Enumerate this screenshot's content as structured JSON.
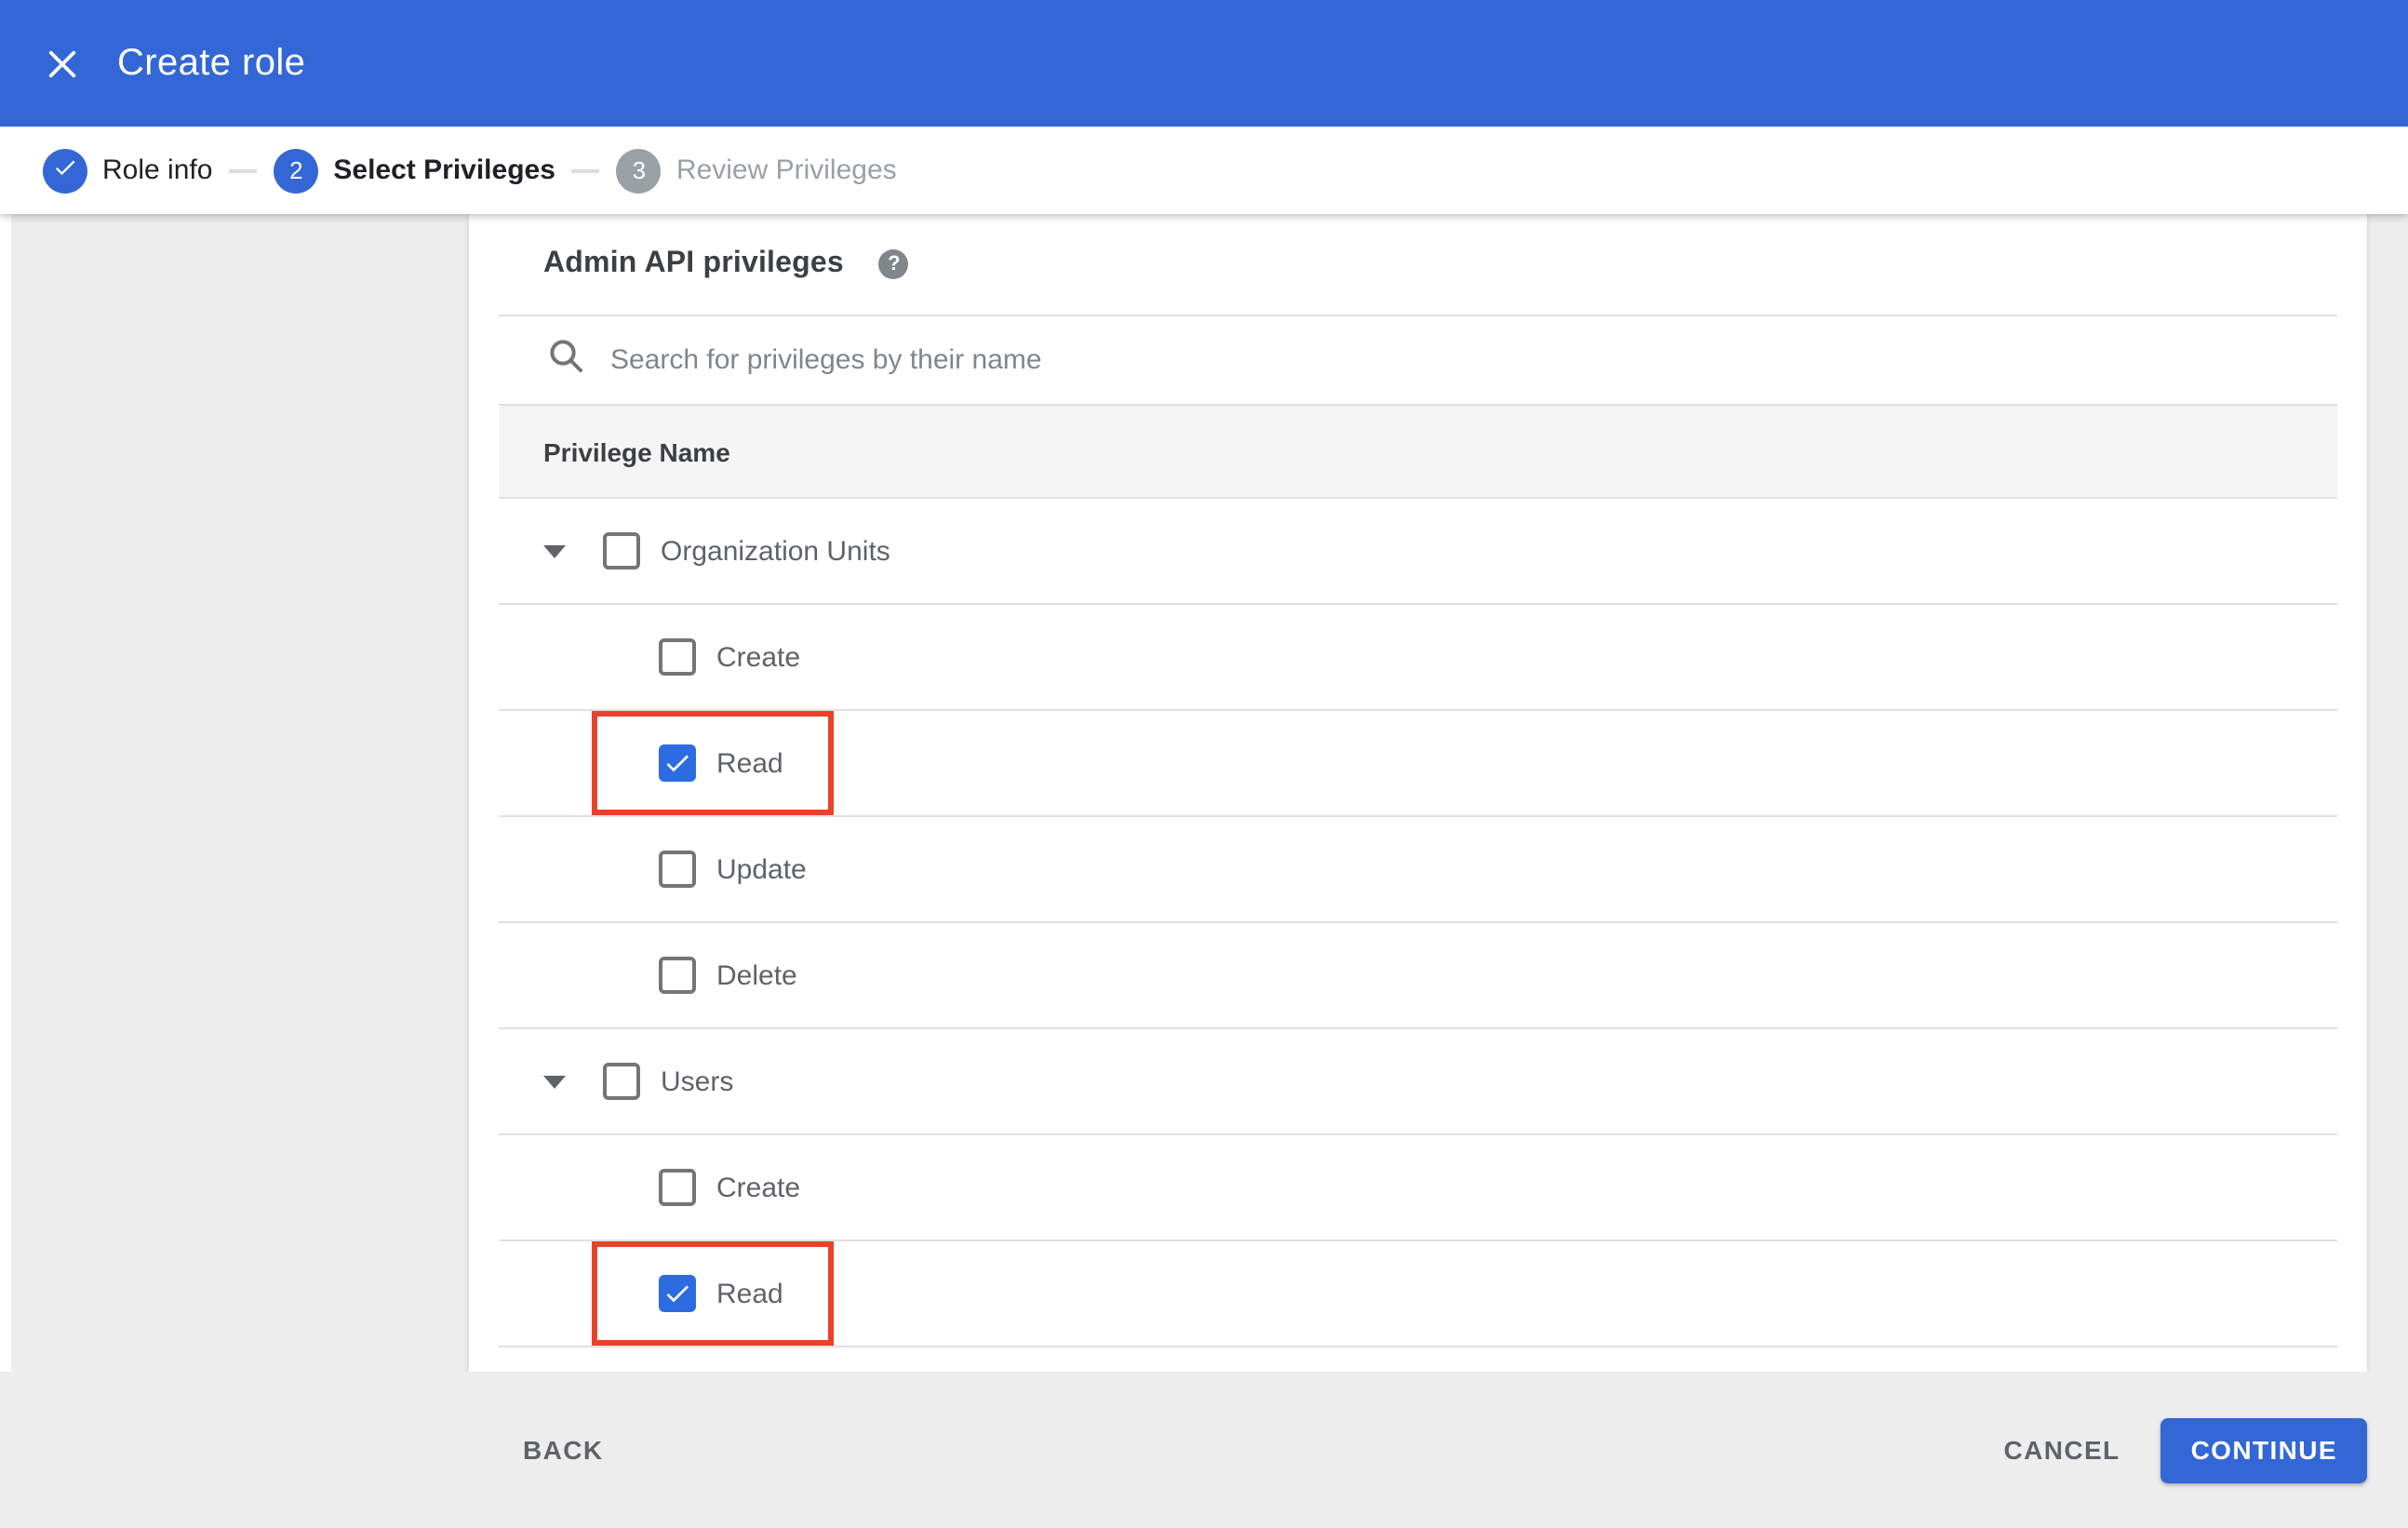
{
  "colors": {
    "accent": "#3367d6",
    "checkbox_checked": "#2d6ce0",
    "highlight_red": "#e8432a",
    "footer_bg": "#ededed"
  },
  "app_bar": {
    "title": "Create role",
    "close_icon": "x-icon"
  },
  "stepper": {
    "steps": [
      {
        "num": "",
        "label": "Role info",
        "state": "done",
        "icon": "check-icon"
      },
      {
        "num": "2",
        "label": "Select Privileges",
        "state": "active"
      },
      {
        "num": "3",
        "label": "Review Privileges",
        "state": "upcoming"
      }
    ]
  },
  "content": {
    "section_title": "Admin API privileges",
    "help_icon": "?",
    "search_placeholder": "Search for privileges by their name",
    "table_header": "Privilege Name",
    "groups": [
      {
        "label": "Organization Units",
        "expanded": true,
        "checked": false,
        "children": [
          {
            "label": "Create",
            "checked": false,
            "highlight": false
          },
          {
            "label": "Read",
            "checked": true,
            "highlight": true
          },
          {
            "label": "Update",
            "checked": false,
            "highlight": false
          },
          {
            "label": "Delete",
            "checked": false,
            "highlight": false
          }
        ]
      },
      {
        "label": "Users",
        "expanded": true,
        "checked": false,
        "children": [
          {
            "label": "Create",
            "checked": false,
            "highlight": false
          },
          {
            "label": "Read",
            "checked": true,
            "highlight": true
          }
        ]
      }
    ]
  },
  "footer": {
    "back": "BACK",
    "cancel": "CANCEL",
    "continue": "CONTINUE"
  }
}
